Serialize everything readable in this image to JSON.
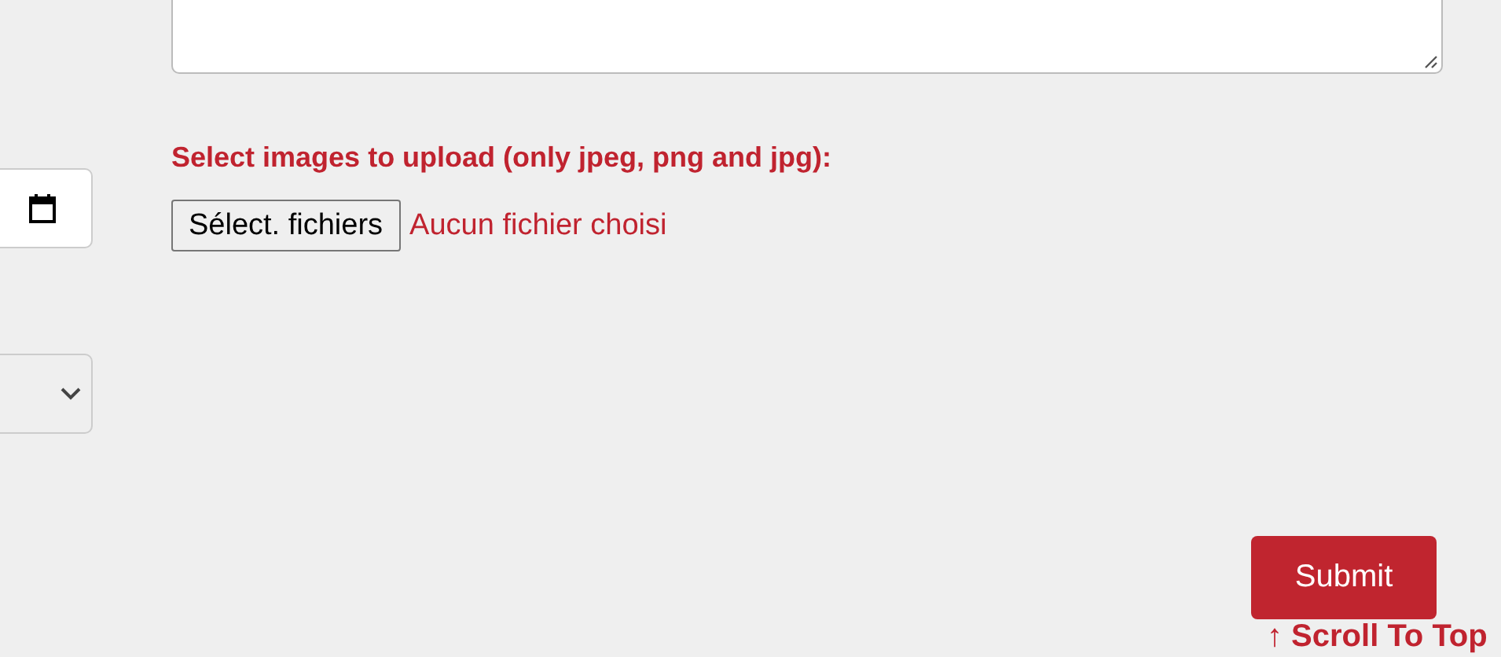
{
  "left_fields": [
    {
      "kind": "date"
    },
    {
      "kind": "select"
    }
  ],
  "upload": {
    "label": "Select images to upload (only jpeg, png and jpg):",
    "button": "Sélect. fichiers",
    "status": "Aucun fichier choisi"
  },
  "submit": "Submit",
  "scroll_top": "↑ Scroll To Top"
}
